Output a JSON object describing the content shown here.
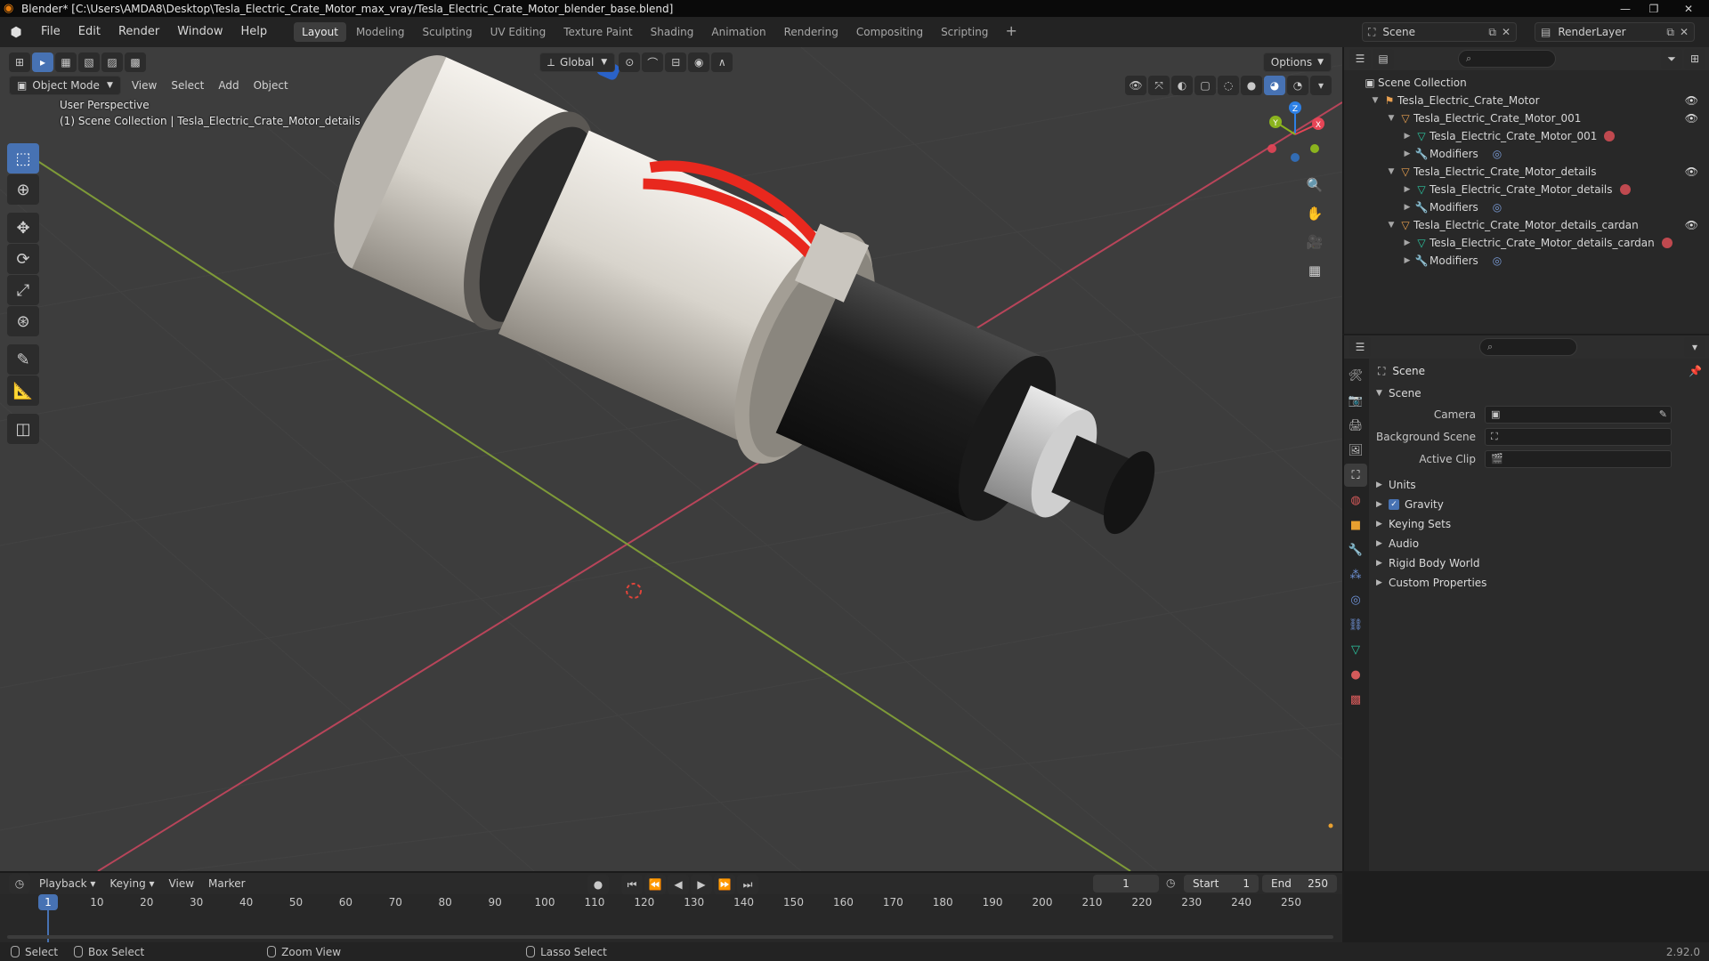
{
  "window": {
    "title": "Blender* [C:\\Users\\AMDA8\\Desktop\\Tesla_Electric_Crate_Motor_max_vray/Tesla_Electric_Crate_Motor_blender_base.blend]"
  },
  "menu": {
    "items": [
      "File",
      "Edit",
      "Render",
      "Window",
      "Help"
    ]
  },
  "workspaces": [
    "Layout",
    "Modeling",
    "Sculpting",
    "UV Editing",
    "Texture Paint",
    "Shading",
    "Animation",
    "Rendering",
    "Compositing",
    "Scripting"
  ],
  "active_workspace": "Layout",
  "scene_selector": {
    "scene": "Scene",
    "view_layer": "RenderLayer"
  },
  "viewport": {
    "mode": "Object Mode",
    "menus": [
      "View",
      "Select",
      "Add",
      "Object"
    ],
    "orientation": "Global",
    "options_label": "Options",
    "perspective_label": "User Perspective",
    "collection_label": "(1) Scene Collection | Tesla_Electric_Crate_Motor_details",
    "gizmo_axes": {
      "x": "X",
      "y": "Y",
      "z": "Z"
    },
    "colors": {
      "x_axis": "#e64556",
      "y_axis": "#8bb31e",
      "z_axis": "#2d80e6",
      "cable": "#e8281e"
    }
  },
  "outliner": {
    "root": "Scene Collection",
    "rows": [
      {
        "label": "Tesla_Electric_Crate_Motor",
        "indent": 1,
        "icon": "collection-icon",
        "eye": true
      },
      {
        "label": "Tesla_Electric_Crate_Motor_001",
        "indent": 2,
        "icon": "object-icon",
        "eye": true
      },
      {
        "label": "Tesla_Electric_Crate_Motor_001",
        "indent": 3,
        "icon": "mesh-icon",
        "eye": false,
        "material": true
      },
      {
        "label": "Modifiers",
        "indent": 3,
        "icon": "wrench-icon",
        "eye": false
      },
      {
        "label": "Tesla_Electric_Crate_Motor_details",
        "indent": 2,
        "icon": "object-icon",
        "eye": true
      },
      {
        "label": "Tesla_Electric_Crate_Motor_details",
        "indent": 3,
        "icon": "mesh-icon",
        "eye": false,
        "material": true
      },
      {
        "label": "Modifiers",
        "indent": 3,
        "icon": "wrench-icon",
        "eye": false
      },
      {
        "label": "Tesla_Electric_Crate_Motor_details_cardan",
        "indent": 2,
        "icon": "object-icon",
        "eye": true
      },
      {
        "label": "Tesla_Electric_Crate_Motor_details_cardan",
        "indent": 3,
        "icon": "mesh-icon",
        "eye": false,
        "material": true
      },
      {
        "label": "Modifiers",
        "indent": 3,
        "icon": "wrench-icon",
        "eye": false
      }
    ]
  },
  "properties": {
    "context": "Scene",
    "panel": "Scene",
    "fields": [
      {
        "label": "Camera",
        "value": ""
      },
      {
        "label": "Background Scene",
        "value": ""
      },
      {
        "label": "Active Clip",
        "value": ""
      }
    ],
    "subpanels": [
      {
        "label": "Units",
        "checkbox": false
      },
      {
        "label": "Gravity",
        "checkbox": true
      },
      {
        "label": "Keying Sets",
        "checkbox": false
      },
      {
        "label": "Audio",
        "checkbox": false
      },
      {
        "label": "Rigid Body World",
        "checkbox": false
      },
      {
        "label": "Custom Properties",
        "checkbox": false
      }
    ]
  },
  "timeline": {
    "menus": [
      "Playback",
      "Keying",
      "View",
      "Marker"
    ],
    "current_frame": "1",
    "start_label": "Start",
    "start": "1",
    "end_label": "End",
    "end": "250",
    "ticks": [
      "10",
      "20",
      "30",
      "40",
      "50",
      "60",
      "70",
      "80",
      "90",
      "100",
      "110",
      "120",
      "130",
      "140",
      "150",
      "160",
      "170",
      "180",
      "190",
      "200",
      "210",
      "220",
      "230",
      "240",
      "250"
    ],
    "playhead": "1"
  },
  "statusbar": {
    "items": [
      "Select",
      "Box Select",
      "Zoom View",
      "Lasso Select"
    ],
    "version": "2.92.0"
  }
}
